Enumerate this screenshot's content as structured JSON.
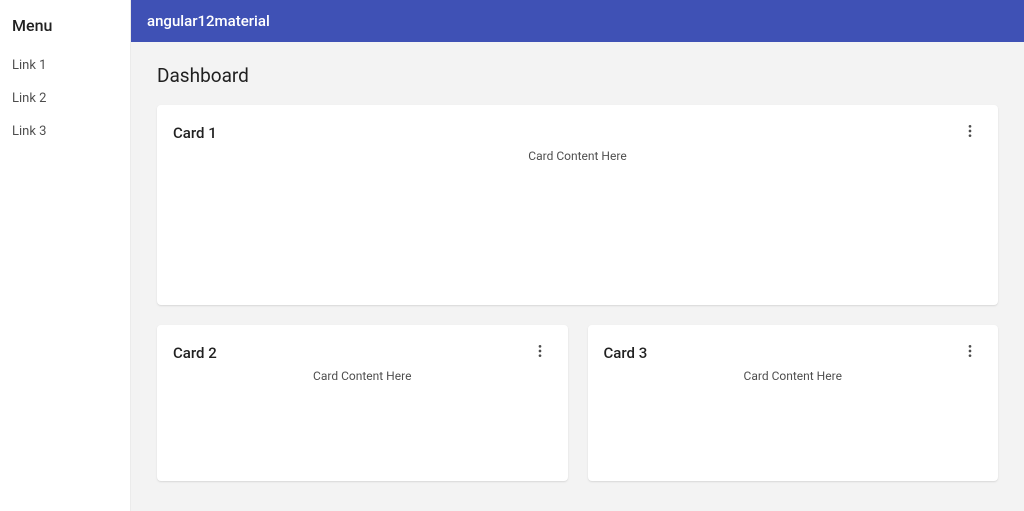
{
  "sidebar": {
    "title": "Menu",
    "links": [
      {
        "label": "Link 1"
      },
      {
        "label": "Link 2"
      },
      {
        "label": "Link 3"
      }
    ]
  },
  "toolbar": {
    "title": "angular12material"
  },
  "page": {
    "title": "Dashboard"
  },
  "cards": [
    {
      "title": "Card 1",
      "content": "Card Content Here"
    },
    {
      "title": "Card 2",
      "content": "Card Content Here"
    },
    {
      "title": "Card 3",
      "content": "Card Content Here"
    }
  ]
}
